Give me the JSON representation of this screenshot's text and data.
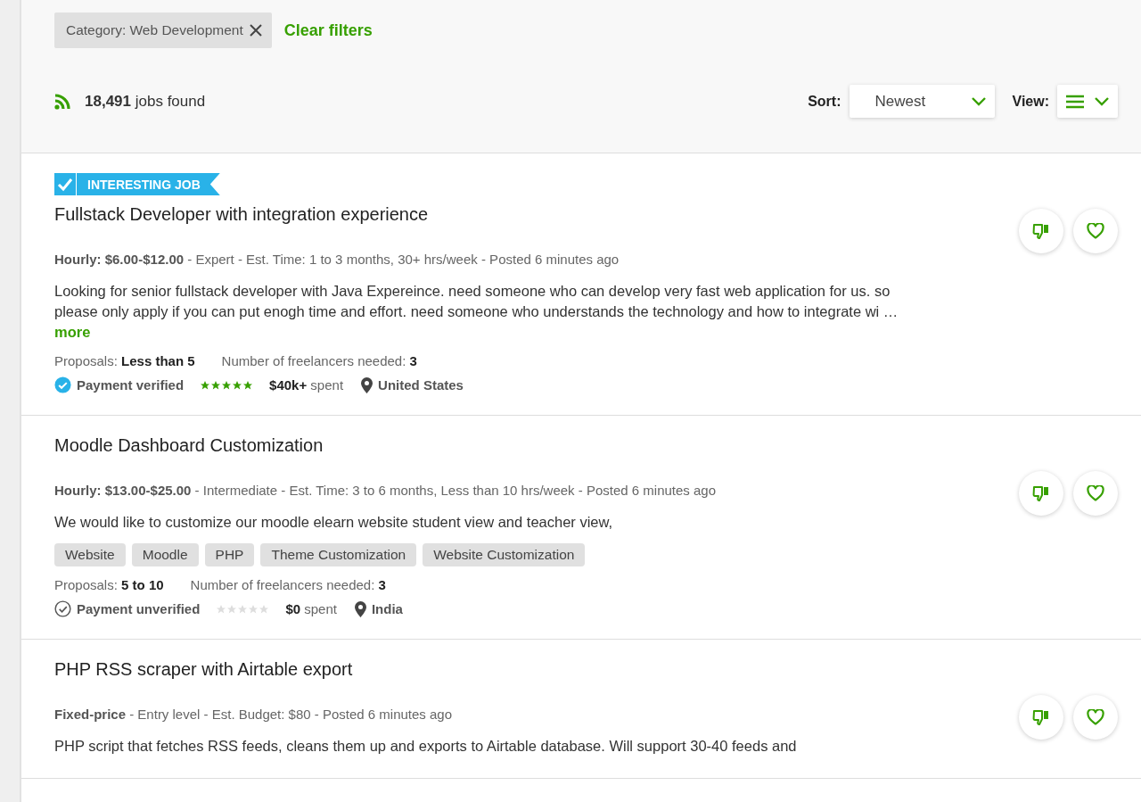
{
  "filters": {
    "chips": [
      {
        "label": "Category: Web Development"
      }
    ],
    "clear": "Clear filters"
  },
  "results": {
    "count": "18,491",
    "suffix": "jobs found"
  },
  "sort": {
    "label": "Sort:",
    "value": "Newest"
  },
  "view": {
    "label": "View:"
  },
  "jobs": [
    {
      "badge": "INTERESTING JOB",
      "title": "Fullstack Developer with integration experience",
      "meta": "**Hourly: $6.00-$12.00** - Expert - Est. Time: 1 to 3 months, 30+ hrs/week - Posted 6 minutes ago",
      "description": "Looking for senior fullstack developer with Java Expereince. need someone who can develop very fast web application for us. so please only apply if you can put enogh time and effort. need someone who understands the technology and how to integrate wi …",
      "more": "more",
      "proposals": "Proposals: **Less than 5**",
      "freelancers": "Number of freelancers needed: **3**",
      "payment_verified": true,
      "payment": "Payment verified",
      "stars": 5,
      "spent": "**$40k+** spent",
      "location": "United States"
    },
    {
      "title": "Moodle Dashboard Customization",
      "meta": "**Hourly: $13.00-$25.00** - Intermediate - Est. Time: 3 to 6 months, Less than 10 hrs/week - Posted 6 minutes ago",
      "description": "We would like to customize our moodle elearn website student view and teacher view,",
      "tags": [
        "Website",
        "Moodle",
        "PHP",
        "Theme Customization",
        "Website Customization"
      ],
      "proposals": "Proposals: **5 to 10**",
      "freelancers": "Number of freelancers needed: **3**",
      "payment_verified": false,
      "payment": "Payment unverified",
      "stars": 0,
      "spent": "**$0** spent",
      "location": "India"
    },
    {
      "title": "PHP RSS scraper with Airtable export",
      "meta": "**Fixed-price** - Entry level - Est. Budget: $80 - Posted 6 minutes ago",
      "description": "PHP script that fetches RSS feeds, cleans them up and exports to Airtable database. Will support 30-40 feeds and"
    }
  ]
}
